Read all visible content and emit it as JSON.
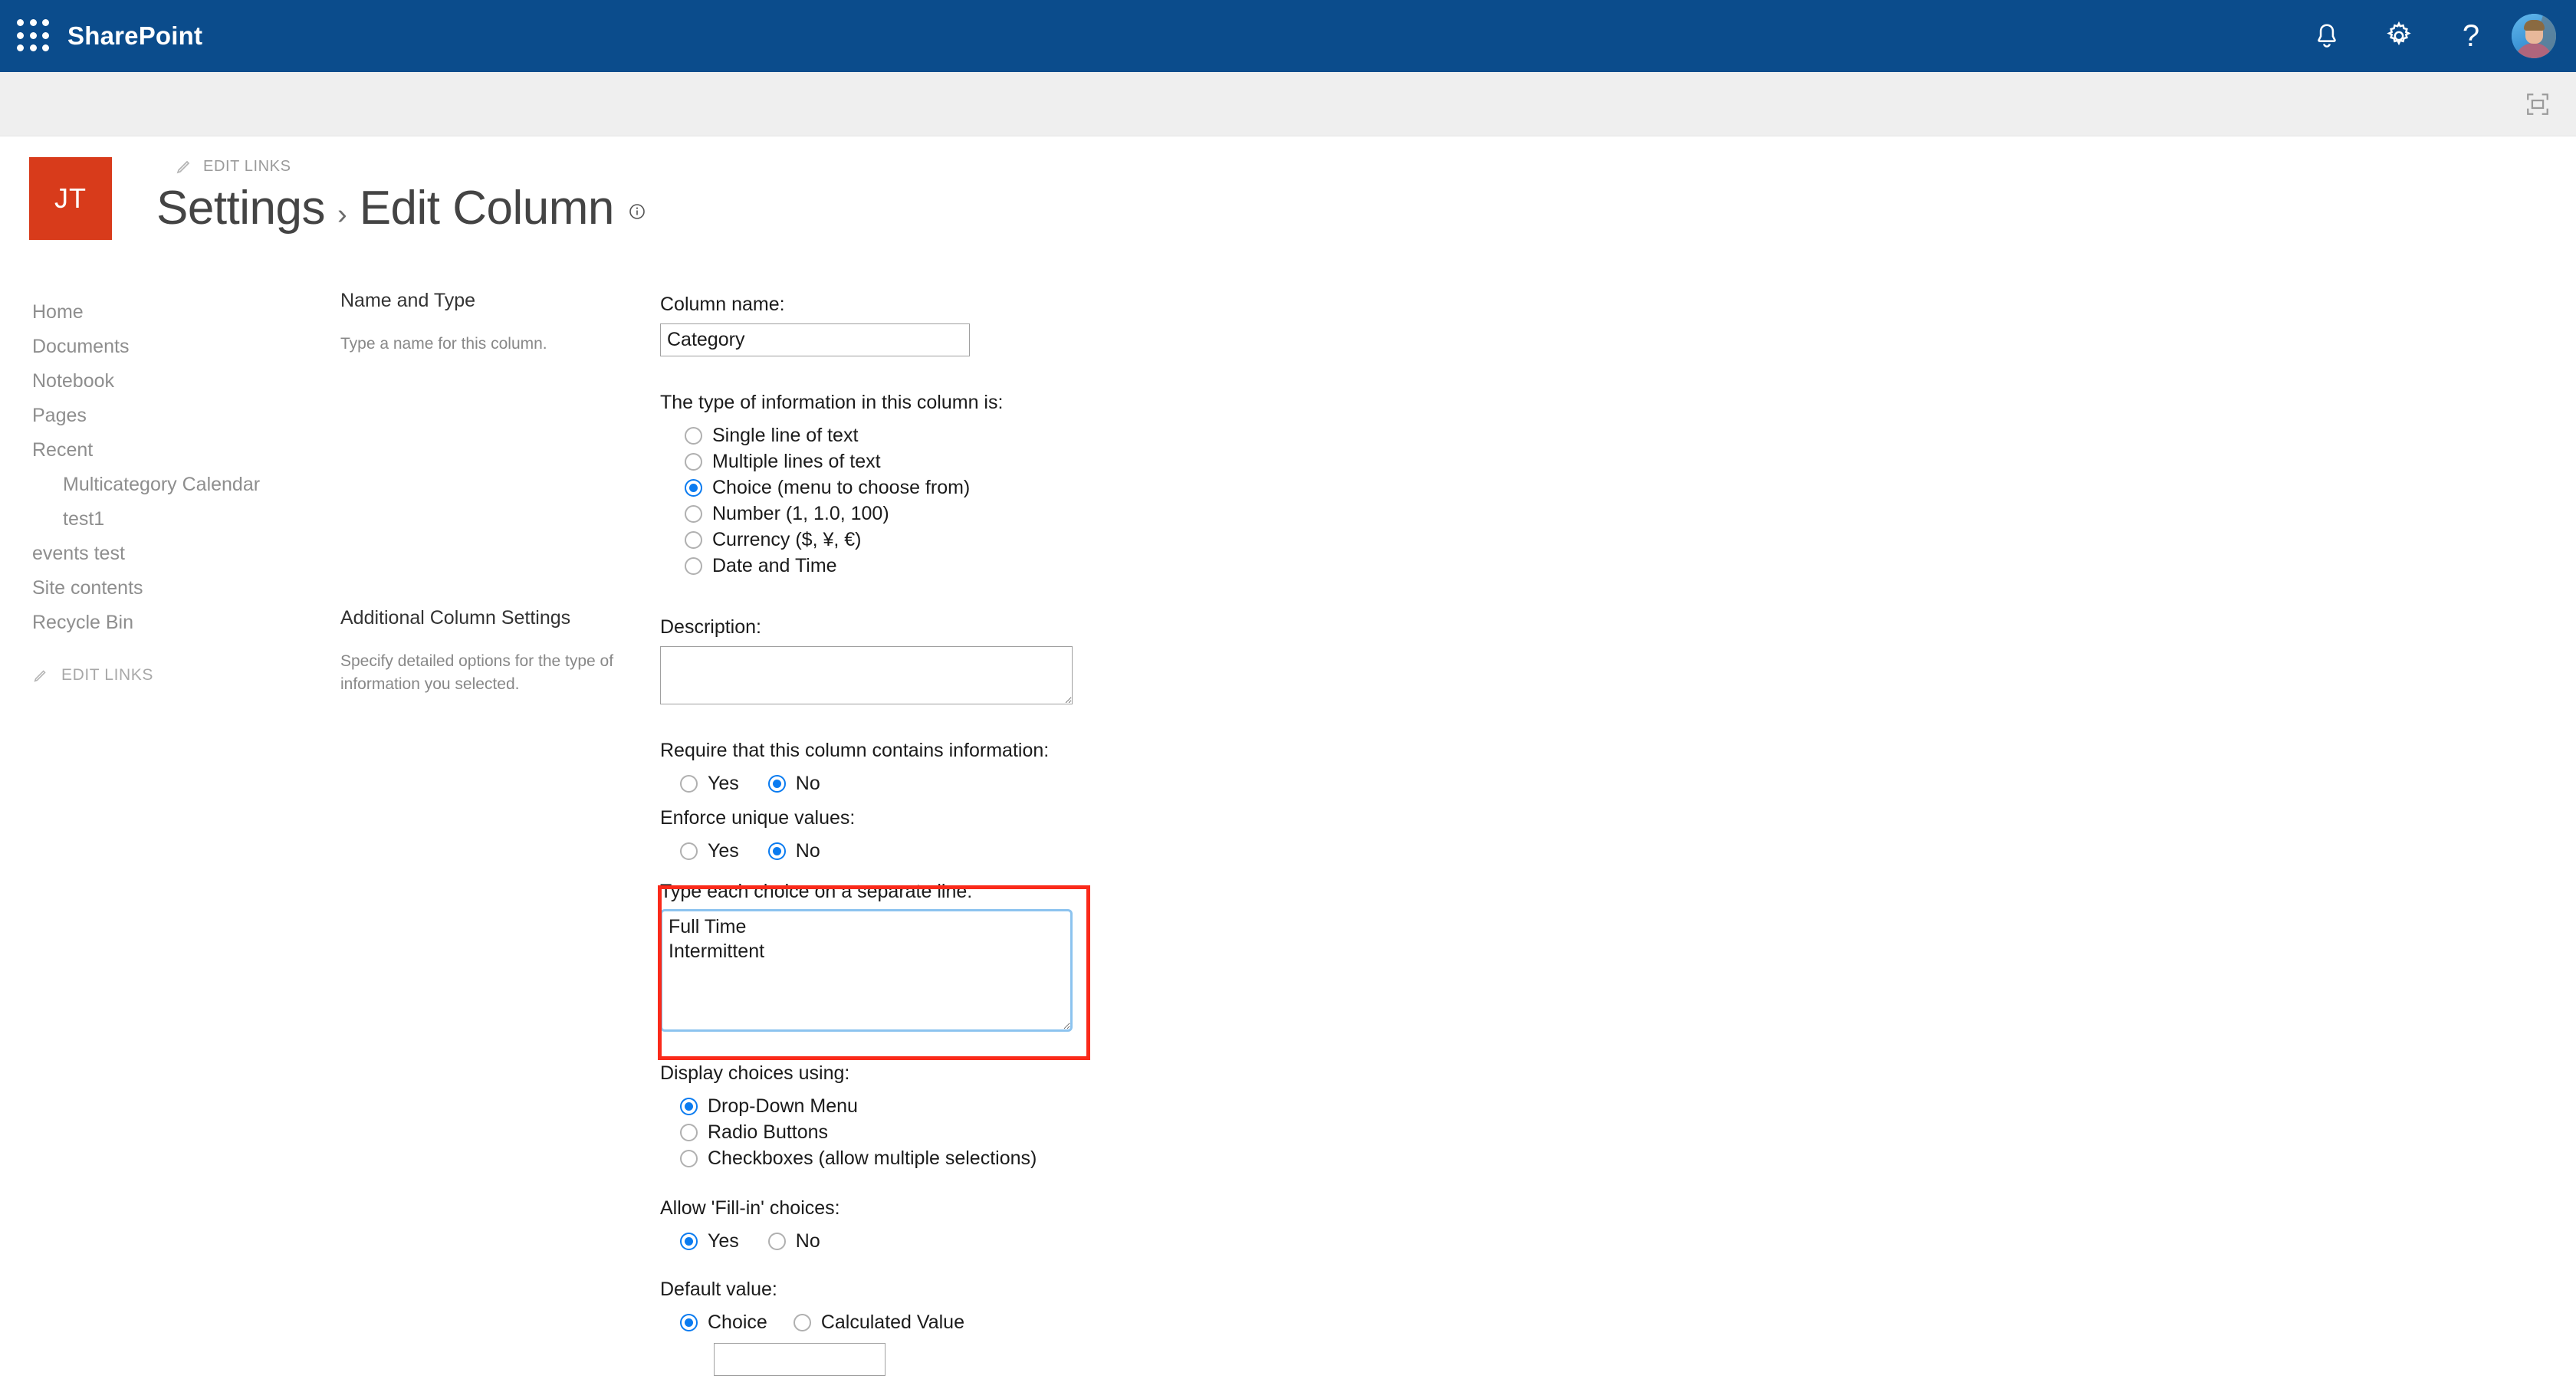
{
  "suite": {
    "app_launcher": "app-launcher",
    "title": "SharePoint",
    "notifications": "notifications",
    "settings": "settings",
    "help": "?",
    "account": "account"
  },
  "subbar": {
    "focus_on_content": "focus-on-content"
  },
  "site": {
    "logo_initials": "JT",
    "edit_links": "EDIT LINKS",
    "breadcrumb_parent": "Settings",
    "breadcrumb_separator": "›",
    "breadcrumb_current": "Edit Column"
  },
  "nav": {
    "items": [
      {
        "label": "Home",
        "child": false
      },
      {
        "label": "Documents",
        "child": false
      },
      {
        "label": "Notebook",
        "child": false
      },
      {
        "label": "Pages",
        "child": false
      },
      {
        "label": "Recent",
        "child": false
      },
      {
        "label": "Multicategory Calendar",
        "child": true
      },
      {
        "label": "test1",
        "child": true
      },
      {
        "label": "events test",
        "child": false
      },
      {
        "label": "Site contents",
        "child": false
      },
      {
        "label": "Recycle Bin",
        "child": false
      }
    ],
    "edit_links": "EDIT LINKS"
  },
  "form": {
    "name_and_type": {
      "section_title": "Name and Type",
      "section_desc": "Type a name for this column.",
      "column_name_label": "Column name:",
      "column_name_value": "Category",
      "type_label": "The type of information in this column is:",
      "type_options": [
        {
          "label": "Single line of text",
          "selected": false
        },
        {
          "label": "Multiple lines of text",
          "selected": false
        },
        {
          "label": "Choice (menu to choose from)",
          "selected": true
        },
        {
          "label": "Number (1, 1.0, 100)",
          "selected": false
        },
        {
          "label": "Currency ($, ¥, €)",
          "selected": false
        },
        {
          "label": "Date and Time",
          "selected": false
        }
      ]
    },
    "additional": {
      "section_title": "Additional Column Settings",
      "section_desc": "Specify detailed options for the type of information you selected.",
      "description_label": "Description:",
      "description_value": "",
      "require_label": "Require that this column contains information:",
      "require_yes": "Yes",
      "require_no": "No",
      "require_selected": "No",
      "unique_label": "Enforce unique values:",
      "unique_yes": "Yes",
      "unique_no": "No",
      "unique_selected": "No",
      "choices_label": "Type each choice on a separate line:",
      "choices_value": "Full Time\nIntermittent",
      "display_label": "Display choices using:",
      "display_options": [
        {
          "label": "Drop-Down Menu",
          "selected": true
        },
        {
          "label": "Radio Buttons",
          "selected": false
        },
        {
          "label": "Checkboxes (allow multiple selections)",
          "selected": false
        }
      ],
      "fillin_label": "Allow 'Fill-in' choices:",
      "fillin_yes": "Yes",
      "fillin_no": "No",
      "fillin_selected": "Yes",
      "default_label": "Default value:",
      "default_choice": "Choice",
      "default_calculated": "Calculated Value",
      "default_selected": "Choice",
      "default_value": ""
    }
  },
  "annotation": {
    "highlight_color": "#fa2a1a",
    "target": "choices-textarea-group"
  },
  "colors": {
    "suite_bar": "#0b4c8c",
    "sub_bar": "#efefef",
    "site_logo": "#d83b1b",
    "radio_accent": "#0a7bf0",
    "focus_border": "#8cc3ef"
  }
}
